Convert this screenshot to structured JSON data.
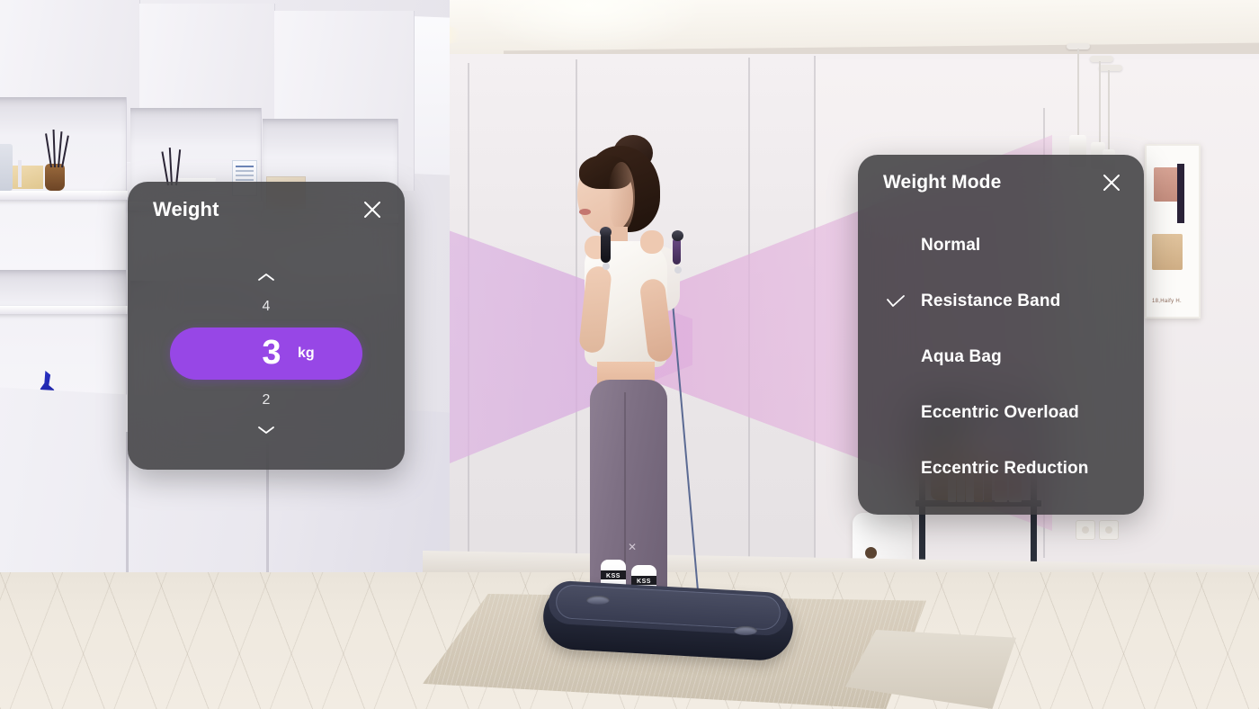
{
  "weight_panel": {
    "title": "Weight",
    "close_icon": "close-icon",
    "increment_icon": "chevron-up-icon",
    "decrement_icon": "chevron-down-icon",
    "value_above": "4",
    "value_below": "2",
    "current_value": "3",
    "unit": "kg",
    "accent_color": "#9747e6"
  },
  "mode_panel": {
    "title": "Weight Mode",
    "close_icon": "close-icon",
    "check_icon": "check-icon",
    "selected": "Resistance Band",
    "options": [
      {
        "label": "Normal",
        "selected": false
      },
      {
        "label": "Resistance Band",
        "selected": true
      },
      {
        "label": "Aqua Bag",
        "selected": false
      },
      {
        "label": "Eccentric Overload",
        "selected": false
      },
      {
        "label": "Eccentric Reduction",
        "selected": false
      }
    ]
  },
  "scene": {
    "sock_text": "KSS",
    "poster_caption": "18,Haify H.",
    "panel_bg": "rgba(48,48,50,0.80)"
  }
}
